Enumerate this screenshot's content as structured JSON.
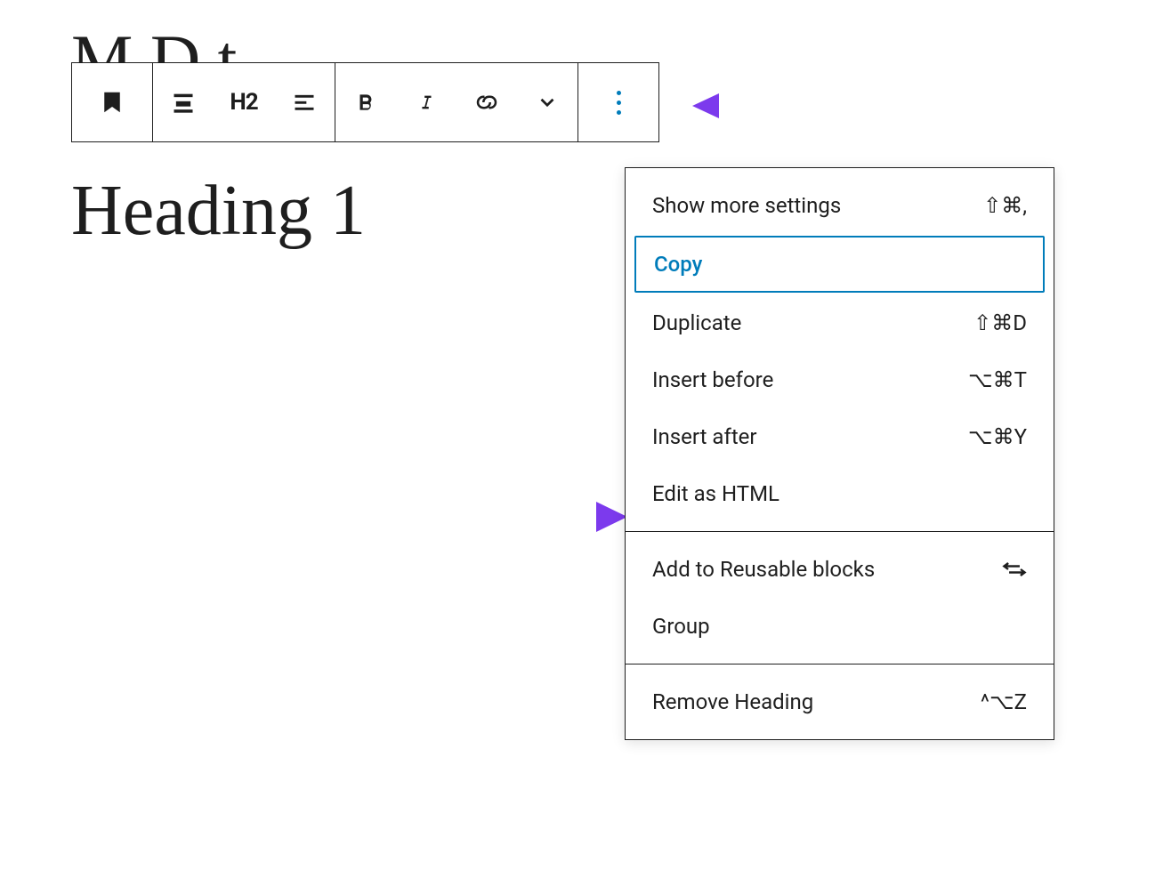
{
  "editor": {
    "partial_title": "M      D       t",
    "heading_text": "Heading 1",
    "heading_level_label": "H2"
  },
  "toolbar": {
    "block_type_icon": "heading-bookmark",
    "align_icon": "align-center",
    "heading_level": "H2",
    "text_align_icon": "align-left",
    "bold_icon": "bold",
    "italic_icon": "italic",
    "link_icon": "link",
    "dropdown_icon": "chevron-down",
    "more_icon": "more-vertical"
  },
  "menu": {
    "sections": [
      {
        "items": [
          {
            "label": "Show more settings",
            "shortcut": "⇧⌘,"
          },
          {
            "label": "Copy",
            "shortcut": "",
            "highlighted": true
          },
          {
            "label": "Duplicate",
            "shortcut": "⇧⌘D"
          },
          {
            "label": "Insert before",
            "shortcut": "⌥⌘T"
          },
          {
            "label": "Insert after",
            "shortcut": "⌥⌘Y"
          },
          {
            "label": "Edit as HTML",
            "shortcut": ""
          }
        ]
      },
      {
        "items": [
          {
            "label": "Add to Reusable blocks",
            "shortcut": "",
            "icon": "reusable"
          },
          {
            "label": "Group",
            "shortcut": ""
          }
        ]
      },
      {
        "items": [
          {
            "label": "Remove Heading",
            "shortcut": "^⌥Z"
          }
        ]
      }
    ]
  },
  "colors": {
    "accent": "#007cba",
    "arrow": "#7c3aed",
    "text": "#1e1e1e"
  }
}
